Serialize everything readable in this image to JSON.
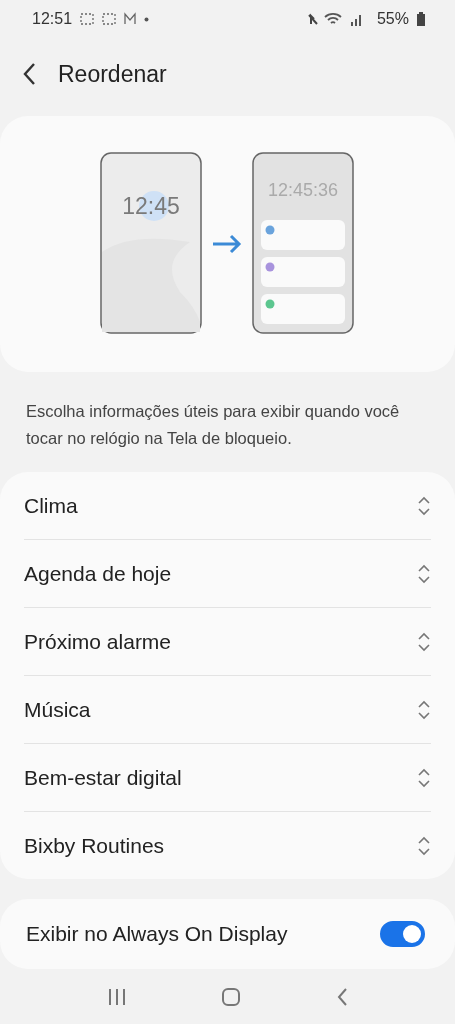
{
  "status_bar": {
    "time": "12:51",
    "battery": "55%"
  },
  "header": {
    "title": "Reordenar"
  },
  "illustration": {
    "before_clock": "12:45",
    "after_clock": "12:45:36",
    "cards": [
      {
        "color": "#6aa3dc"
      },
      {
        "color": "#a893dd"
      },
      {
        "color": "#5cc68f"
      }
    ]
  },
  "description": "Escolha informações úteis para exibir quando você tocar no relógio na Tela de bloqueio.",
  "items": [
    {
      "label": "Clima"
    },
    {
      "label": "Agenda de hoje"
    },
    {
      "label": "Próximo alarme"
    },
    {
      "label": "Música"
    },
    {
      "label": "Bem-estar digital"
    },
    {
      "label": "Bixby Routines"
    }
  ],
  "always_on": {
    "label": "Exibir no Always On Display",
    "on": true
  }
}
